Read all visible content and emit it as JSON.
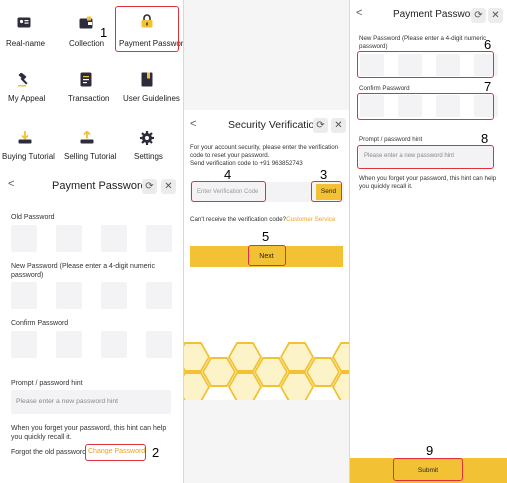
{
  "menu": {
    "items": [
      {
        "label": "Real-name",
        "icon": "id-card-icon"
      },
      {
        "label": "Collection",
        "icon": "wallet-icon"
      },
      {
        "label": "Payment Password",
        "icon": "lock-icon"
      },
      {
        "label": "My Appeal",
        "icon": "hammer-icon"
      },
      {
        "label": "Transaction",
        "icon": "document-icon"
      },
      {
        "label": "User Guidelines",
        "icon": "book-icon"
      },
      {
        "label": "Buying Tutorial",
        "icon": "download-icon"
      },
      {
        "label": "Selling Tutorial",
        "icon": "upload-icon"
      },
      {
        "label": "Settings",
        "icon": "gear-icon"
      }
    ]
  },
  "annotations": {
    "n1": "1",
    "n2": "2",
    "n3": "3",
    "n4": "4",
    "n5": "5",
    "n6": "6",
    "n7": "7",
    "n8": "8",
    "n9": "9"
  },
  "panel_left": {
    "back": "<",
    "title": "Payment Password",
    "refresh": "⟳",
    "close": "✕",
    "old_password_label": "Old Password",
    "new_password_label": "New Password (Please enter a 4-digit numeric password)",
    "confirm_password_label": "Confirm Password",
    "hint_label": "Prompt / password hint",
    "hint_placeholder": "Please enter a new password hint",
    "hint_help": "When you forget your password, this hint can help you quickly recall it.",
    "forgot_text": "Forgot the old password",
    "change_link": "Change Password"
  },
  "panel_middle": {
    "back": "<",
    "title": "Security Verification",
    "refresh": "⟳",
    "close": "✕",
    "info": "For your account security, please enter the verification code to reset your password.",
    "send_to": "Send verification code to +91 963852743",
    "code_placeholder": "Enter Verification Code",
    "send_button": "Send",
    "cant_receive": "Can't receive the verification code?",
    "customer_service": "Customer Service",
    "next_button": "Next"
  },
  "panel_right": {
    "back": "<",
    "title": "Payment Password",
    "refresh": "⟳",
    "close": "✕",
    "new_password_label": "New Password (Please enter a 4-digit numeric password)",
    "confirm_password_label": "Confirm Password",
    "hint_label": "Prompt / password hint",
    "hint_placeholder": "Please enter a new password hint",
    "hint_help": "When you forget your password, this hint can help you quickly recall it.",
    "submit_button": "Submit"
  },
  "colors": {
    "accent": "#f2c234",
    "link": "#f0a020",
    "annotation_box": "#e0303a"
  }
}
